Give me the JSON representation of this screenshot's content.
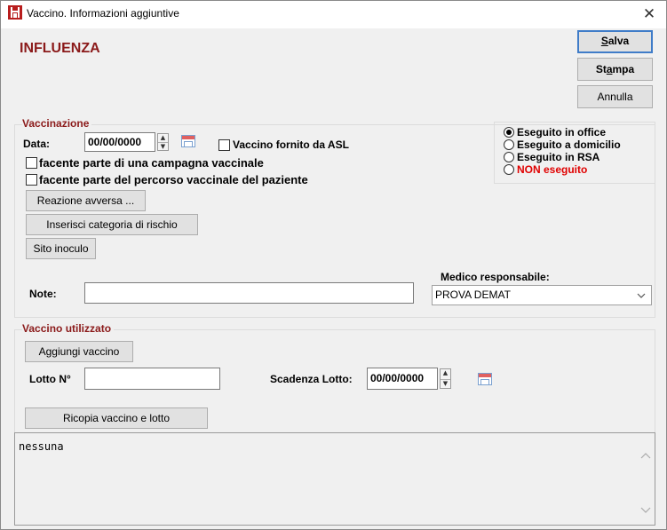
{
  "window": {
    "title": "Vaccino. Informazioni aggiuntive",
    "close_glyph": "✕"
  },
  "heading": "INFLUENZA",
  "buttons": {
    "salva_prefix": "",
    "salva_mnemonic": "S",
    "salva_rest": "alva",
    "stampa_prefix": "St",
    "stampa_mnemonic": "a",
    "stampa_rest": "mpa",
    "annulla": "Annulla"
  },
  "vaccinazione": {
    "title": "Vaccinazione",
    "data_label": "Data:",
    "data_value": "00/00/0000",
    "vaccino_asl": "Vaccino fornito da ASL",
    "campagna": "facente parte di una campagna vaccinale",
    "percorso": "facente parte del percorso vaccinale del paziente",
    "reazione_button": "Reazione avversa ...",
    "categoria_button": "Inserisci categoria di rischio",
    "sito_button": "Sito inoculo",
    "note_label": "Note:",
    "note_value": "",
    "medico_label": "Medico responsabile:",
    "medico_value": "PROVA DEMAT",
    "esecuzione": [
      {
        "label": "Eseguito in office",
        "selected": true
      },
      {
        "label": "Eseguito a domicilio",
        "selected": false
      },
      {
        "label": "Eseguito in RSA",
        "selected": false
      },
      {
        "label": "NON eseguito",
        "selected": false
      }
    ],
    "non_eseguito_color": "#e00000"
  },
  "vaccino_utilizzato": {
    "title": "Vaccino utilizzato",
    "aggiungi_button": "Aggiungi vaccino",
    "lotto_label": "Lotto N°",
    "lotto_value": "",
    "scadenza_label": "Scadenza Lotto:",
    "scadenza_value": "00/00/0000",
    "ricopia_button": "Ricopia vaccino e lotto"
  },
  "memo": {
    "text": "nessuna"
  },
  "colors": {
    "heading": "#8b1a1a",
    "default_button_border": "#3f7cc8"
  },
  "icons": {
    "app": "syringe-app-icon",
    "calendar": "calendar-icon",
    "dropdown": "chevron-down-icon"
  }
}
